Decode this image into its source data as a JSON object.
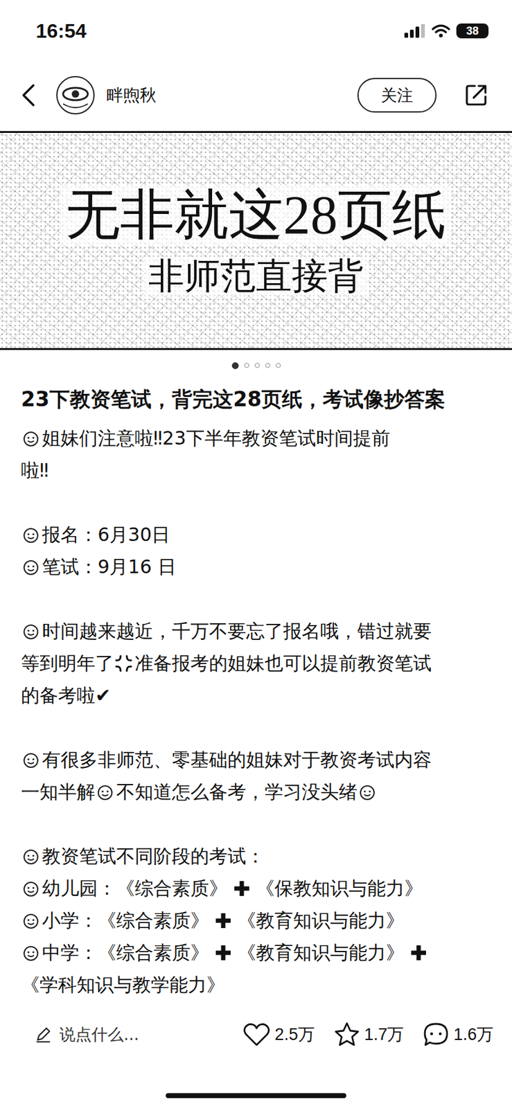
{
  "status_bar": {
    "time": "16:54",
    "battery": "38",
    "signal_level": 0.75
  },
  "header": {
    "author": "畔煦秋",
    "follow_button": "关注"
  },
  "cover": {
    "title": "无非就这28页纸",
    "subtitle": "非师范直接背",
    "pages": [
      {
        "selected": true
      },
      {
        "selected": false
      },
      {
        "selected": false
      },
      {
        "selected": false
      },
      {
        "selected": false
      }
    ]
  },
  "post": {
    "title": "23下教资笔试，背完这28页纸，考试像抄答案",
    "paragraphs": [
      [
        [
          {
            "kind": "emoji"
          },
          {
            "kind": "text",
            "text": "姐妹们注意啦‼23下半年教资笔试时间提前"
          }
        ],
        [
          {
            "kind": "text",
            "text": "啦‼"
          }
        ]
      ],
      [
        [
          {
            "kind": "emoji"
          },
          {
            "kind": "text",
            "text": "报名：6月30日"
          }
        ],
        [
          {
            "kind": "emoji"
          },
          {
            "kind": "text",
            "text": "笔试：9月16 日"
          }
        ]
      ],
      [
        [
          {
            "kind": "emoji"
          },
          {
            "kind": "text",
            "text": "时间越来越近，千万不要忘了报名哦，错过就要"
          }
        ],
        [
          {
            "kind": "text",
            "text": "等到明年了"
          },
          {
            "kind": "anger"
          },
          {
            "kind": "text",
            "text": "准备报考的姐妹也可以提前教资笔试"
          }
        ],
        [
          {
            "kind": "text",
            "text": "的备考啦✔"
          }
        ]
      ],
      [
        [
          {
            "kind": "emoji"
          },
          {
            "kind": "text",
            "text": "有很多非师范、零基础的姐妹对于教资考试内容"
          }
        ],
        [
          {
            "kind": "text",
            "text": "一知半解"
          },
          {
            "kind": "emoji"
          },
          {
            "kind": "text",
            "text": "不知道怎么备考，学习没头绪"
          },
          {
            "kind": "emoji"
          }
        ]
      ],
      [
        [
          {
            "kind": "emoji"
          },
          {
            "kind": "text",
            "text": "教资笔试不同阶段的考试："
          }
        ],
        [
          {
            "kind": "emoji"
          },
          {
            "kind": "text",
            "text": "幼儿园：《综合素质》"
          },
          {
            "kind": "plus"
          },
          {
            "kind": "text",
            "text": "《保教知识与能力》"
          }
        ],
        [
          {
            "kind": "emoji"
          },
          {
            "kind": "text",
            "text": "小学：《综合素质》"
          },
          {
            "kind": "plus"
          },
          {
            "kind": "text",
            "text": "《教育知识与能力》"
          }
        ],
        [
          {
            "kind": "emoji"
          },
          {
            "kind": "text",
            "text": "中学：《综合素质》"
          },
          {
            "kind": "plus"
          },
          {
            "kind": "text",
            "text": "《教育知识与能力》"
          },
          {
            "kind": "plus"
          }
        ],
        [
          {
            "kind": "text",
            "text": "《学科知识与教学能力》"
          }
        ]
      ]
    ]
  },
  "bottom_bar": {
    "comment_placeholder": "说点什么...",
    "likes": "2.5万",
    "favorites": "1.7万",
    "comments": "1.6万"
  }
}
